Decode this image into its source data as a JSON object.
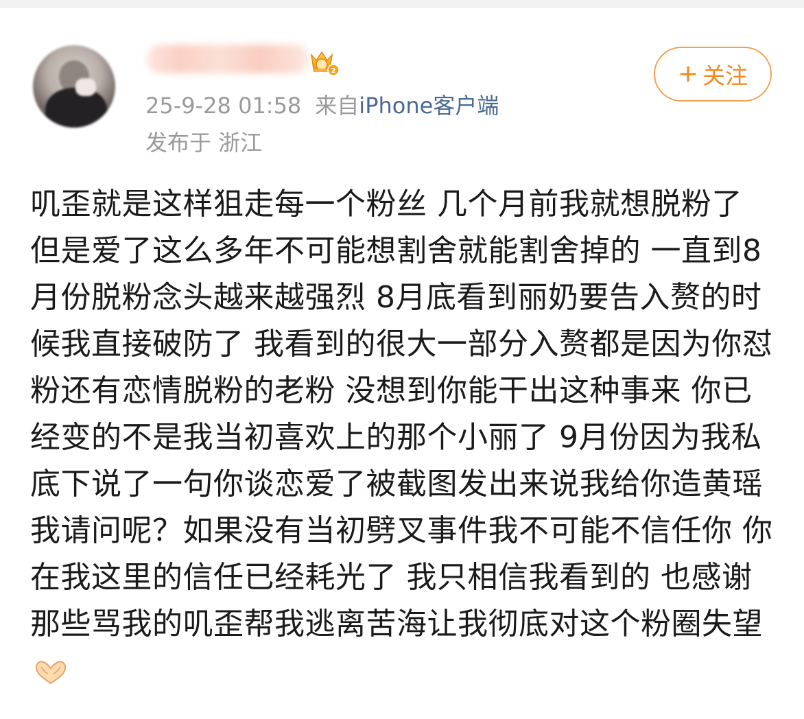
{
  "post": {
    "author": {
      "avatar_icon": "user-avatar-blurred",
      "badge_icon": "vip-crown-badge"
    },
    "timestamp": "25-9-28 01:58",
    "source_prefix": "来自",
    "source_link": "iPhone客户端",
    "location": "发布于 浙江",
    "follow_button": {
      "icon": "plus-icon",
      "plus": "+",
      "label": "关注"
    },
    "body_text": "叽歪就是这样狙走每一个粉丝 几个月前我就想脱粉了 但是爱了这么多年不可能想割舍就能割舍掉的 一直到8月份脱粉念头越来越强烈 8月底看到丽奶要告入赘的时候我直接破防了 我看到的很大一部分入赘都是因为你怼粉还有恋情脱粉的老粉 没想到你能干出这种事来 你已经变的不是我当初喜欢上的那个小丽了 9月份因为我私底下说了一句你谈恋爱了被截图发出来说我给你造黄瑶 我请问呢？如果没有当初劈叉事件我不可能不信任你 你在我这里的信任已经耗光了 我只相信我看到的 也感谢那些骂我的叽歪帮我逃离苦海让我彻底对这个粉圈失望",
    "trailing_emoji": "heart-hands-icon"
  },
  "colors": {
    "follow_accent": "#f08a1f",
    "link_blue": "#4a6a96",
    "meta_gray": "#9a9a9a",
    "text": "#1a1a1a"
  }
}
